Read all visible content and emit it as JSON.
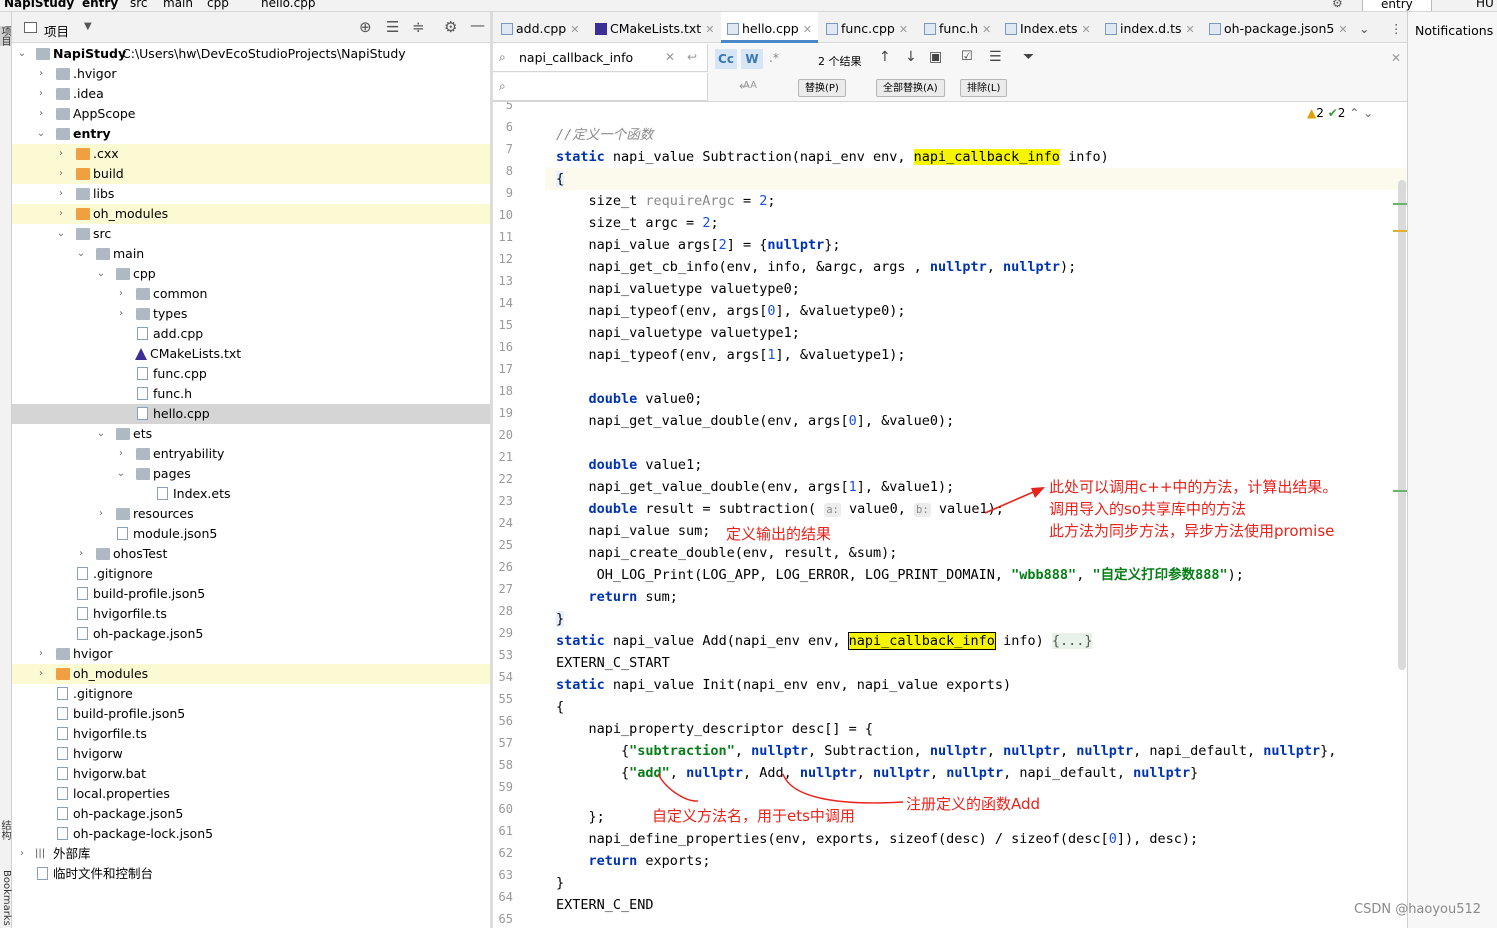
{
  "breadcrumb": {
    "items": [
      "NapiStudy",
      "entry",
      "src",
      "main",
      "cpp",
      "hello.cpp"
    ]
  },
  "top_right": {
    "config": "entry",
    "extra": "HU"
  },
  "project_panel": {
    "title": "项目",
    "side_label_top": "项目",
    "side_label_mid": "结构",
    "side_label_bottom": "Bookmarks",
    "tree": [
      {
        "label": "NapiStudy",
        "path": "C:\\Users\\hw\\DevEcoStudioProjects\\NapiStudy",
        "bold": true
      },
      {
        "label": ".hvigor"
      },
      {
        "label": ".idea"
      },
      {
        "label": "AppScope"
      },
      {
        "label": "entry",
        "bold": true
      },
      {
        "label": ".cxx"
      },
      {
        "label": "build"
      },
      {
        "label": "libs"
      },
      {
        "label": "oh_modules"
      },
      {
        "label": "src"
      },
      {
        "label": "main"
      },
      {
        "label": "cpp"
      },
      {
        "label": "common"
      },
      {
        "label": "types"
      },
      {
        "label": "add.cpp"
      },
      {
        "label": "CMakeLists.txt"
      },
      {
        "label": "func.cpp"
      },
      {
        "label": "func.h"
      },
      {
        "label": "hello.cpp"
      },
      {
        "label": "ets"
      },
      {
        "label": "entryability"
      },
      {
        "label": "pages"
      },
      {
        "label": "Index.ets"
      },
      {
        "label": "resources"
      },
      {
        "label": "module.json5"
      },
      {
        "label": "ohosTest"
      },
      {
        "label": ".gitignore"
      },
      {
        "label": "build-profile.json5"
      },
      {
        "label": "hvigorfile.ts"
      },
      {
        "label": "oh-package.json5"
      },
      {
        "label": "hvigor"
      },
      {
        "label": "oh_modules"
      },
      {
        "label": ".gitignore"
      },
      {
        "label": "build-profile.json5"
      },
      {
        "label": "hvigorfile.ts"
      },
      {
        "label": "hvigorw"
      },
      {
        "label": "hvigorw.bat"
      },
      {
        "label": "local.properties"
      },
      {
        "label": "oh-package.json5"
      },
      {
        "label": "oh-package-lock.json5"
      },
      {
        "label": "外部库"
      },
      {
        "label": "临时文件和控制台"
      }
    ]
  },
  "tabs": [
    "add.cpp",
    "CMakeLists.txt",
    "hello.cpp",
    "func.cpp",
    "func.h",
    "Index.ets",
    "index.d.ts",
    "oh-package.json5"
  ],
  "notifications": "Notifications",
  "find": {
    "query": "napi_callback_info",
    "result_count": "2 个结果",
    "replace_value": "",
    "case_btn": "Cc",
    "word_btn": "W",
    "regex_btn": ".*",
    "replace_btn": "替换(P)",
    "replace_all_btn": "全部替换(A)",
    "exclude_btn": "排除(L)"
  },
  "inspections": {
    "warnings": "2",
    "weak": "2"
  },
  "code": {
    "line_numbers": [
      "5",
      "6",
      "7",
      "8",
      "9",
      "10",
      "11",
      "12",
      "13",
      "14",
      "15",
      "16",
      "17",
      "18",
      "19",
      "20",
      "21",
      "22",
      "23",
      "24",
      "25",
      "26",
      "27",
      "28",
      "29",
      "53",
      "54",
      "55",
      "56",
      "57",
      "58",
      "59",
      "60",
      "61",
      "62",
      "63",
      "64",
      "65"
    ],
    "l6": "//定义一个函数",
    "l7a": "static",
    "l7b": " napi_value Subtraction(napi_env env, ",
    "l7c": "napi_callback_info",
    "l7d": " info)",
    "l8": "{",
    "l9a": "    size_t ",
    "l9b": "requireArgc",
    "l9c": " = ",
    "l9d": "2",
    "l9e": ";",
    "l10a": "    size_t argc = ",
    "l10b": "2",
    "l10c": ";",
    "l11a": "    napi_value args[",
    "l11b": "2",
    "l11c": "] = {",
    "l11d": "nullptr",
    "l11e": "};",
    "l12a": "    napi_get_cb_info(env, info, &argc, args , ",
    "l12b": "nullptr",
    "l12c": ", ",
    "l12d": "nullptr",
    "l12e": ");",
    "l13": "    napi_valuetype valuetype0;",
    "l14a": "    napi_typeof(env, args[",
    "l14b": "0",
    "l14c": "], &valuetype0);",
    "l15": "    napi_valuetype valuetype1;",
    "l16a": "    napi_typeof(env, args[",
    "l16b": "1",
    "l16c": "], &valuetype1);",
    "l18a": "    ",
    "l18b": "double",
    "l18c": " value0;",
    "l19a": "    napi_get_value_double(env, args[",
    "l19b": "0",
    "l19c": "], &value0);",
    "l21a": "    ",
    "l21b": "double",
    "l21c": " value1;",
    "l22a": "    napi_get_value_double(env, args[",
    "l22b": "1",
    "l22c": "], &value1);",
    "l23a": "    ",
    "l23b": "double",
    "l23c": " result = subtraction( ",
    "l23h1": "a:",
    "l23d": " value0, ",
    "l23h2": "b:",
    "l23e": " value1);",
    "l24": "    napi_value sum;",
    "l25": "    napi_create_double(env, result, &sum);",
    "l26a": "     OH_LOG_Print(LOG_APP, LOG_ERROR, LOG_PRINT_DOMAIN, ",
    "l26b": "\"wbb888\"",
    "l26c": ", ",
    "l26d": "\"自定义打印参数888\"",
    "l26e": ");",
    "l27a": "    ",
    "l27b": "return",
    "l27c": " sum;",
    "l28": "}",
    "l29a": "static",
    "l29b": " napi_value Add(napi_env env, ",
    "l29c": "napi_callback_info",
    "l29d": " info) ",
    "l29e": "{...}",
    "l53": "EXTERN_C_START",
    "l54a": "static",
    "l54b": " napi_value Init(napi_env env, napi_value exports)",
    "l55": "{",
    "l56": "    napi_property_descriptor desc[] = {",
    "l57a": "        {",
    "l57b": "\"subtraction\"",
    "l57c": ", ",
    "l57d": "nullptr",
    "l57e": ", Subtraction, ",
    "l57f": "nullptr",
    "l57g": ", ",
    "l57h": "nullptr",
    "l57i": ", ",
    "l57j": "nullptr",
    "l57k": ", napi_default, ",
    "l57l": "nullptr",
    "l57m": "},",
    "l58a": "        {",
    "l58b": "\"add\"",
    "l58c": ", ",
    "l58d": "nullptr",
    "l58e": ", Add, ",
    "l58f": "nullptr",
    "l58g": ", ",
    "l58h": "nullptr",
    "l58i": ", ",
    "l58j": "nullptr",
    "l58k": ", napi_default, ",
    "l58l": "nullptr",
    "l58m": "}",
    "l60": "    };",
    "l61a": "    napi_define_properties(env, exports, sizeof(desc) / sizeof(desc[",
    "l61b": "0",
    "l61c": "]), desc);",
    "l62a": "    ",
    "l62b": "return",
    "l62c": " exports;",
    "l63": "}",
    "l64": "EXTERN_C_END"
  },
  "annotations": {
    "a1": "此处可以调用c++中的方法，计算出结果。",
    "a2": "调用导入的so共享库中的方法",
    "a3": "此方法为同步方法，异步方法使用promise",
    "a4": "定义输出的结果",
    "a5": "注册定义的函数Add",
    "a6": "自定义方法名，用于ets中调用"
  },
  "watermark": "CSDN @haoyou512",
  "colors": {
    "keyword": "#0033b3",
    "string": "#067d17",
    "number": "#1750eb",
    "comment": "#8c8c8c",
    "annotation": "#e8231c",
    "highlight": "#f5f500"
  }
}
